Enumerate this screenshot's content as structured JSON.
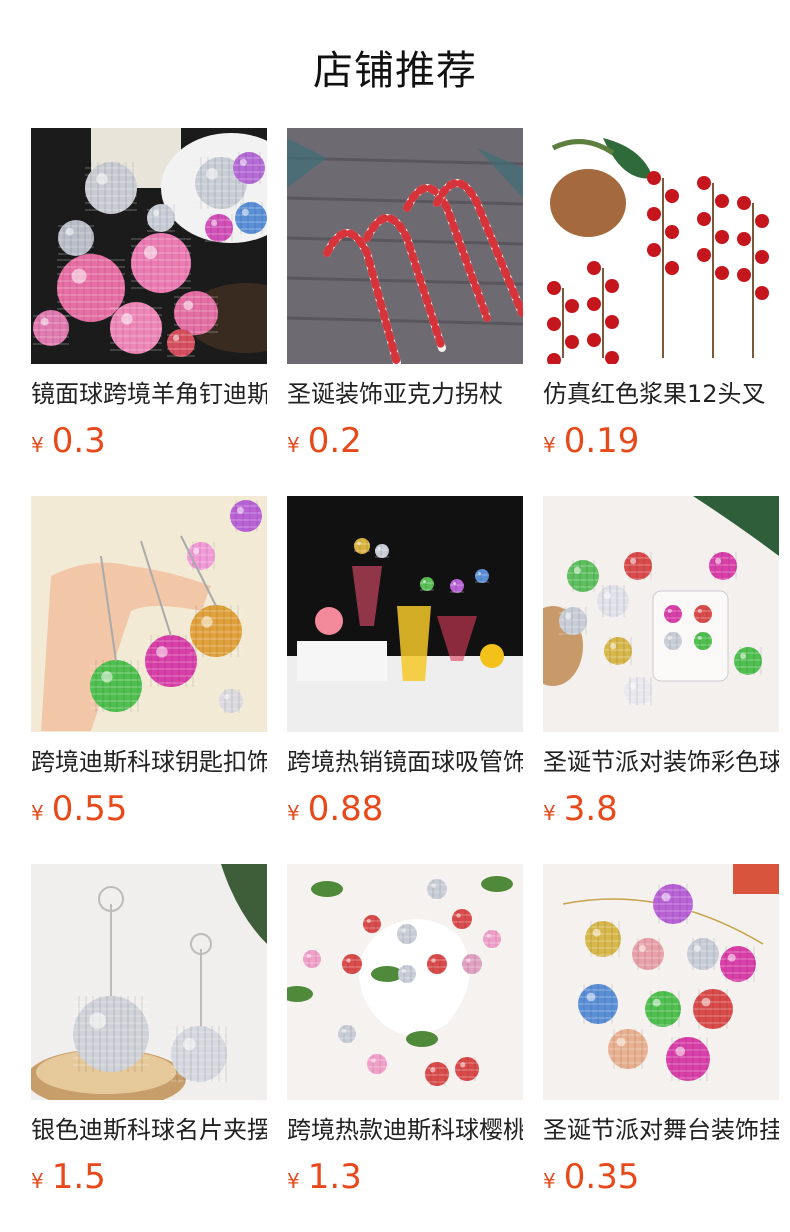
{
  "page_title": "店铺推荐",
  "currency_symbol": "¥",
  "colors": {
    "price": "#e8491b"
  },
  "products": [
    {
      "name": "镜面球跨境羊角钉迪斯科球",
      "price": "0.3",
      "image": "disco-balls-with-wine-bottle"
    },
    {
      "name": "圣诞装饰亚克力拐杖",
      "price": "0.2",
      "image": "candy-canes-on-wood"
    },
    {
      "name": "仿真红色浆果12头叉",
      "price": "0.19",
      "image": "red-berries-pinecone"
    },
    {
      "name": "跨境迪斯科球钥匙扣饰品",
      "price": "0.55",
      "image": "disco-ball-keychains-in-hand"
    },
    {
      "name": "跨境热销镜面球吸管饰品",
      "price": "0.88",
      "image": "disco-ball-straws-drinks"
    },
    {
      "name": "圣诞节派对装饰彩色球",
      "price": "3.8",
      "image": "colored-ornament-balls-box"
    },
    {
      "name": "银色迪斯科球名片夹摆件",
      "price": "1.5",
      "image": "silver-disco-ball-card-holders"
    },
    {
      "name": "跨境热款迪斯科球樱桃挂件",
      "price": "1.3",
      "image": "disco-ball-cherries"
    },
    {
      "name": "圣诞节派对舞台装饰挂球",
      "price": "0.35",
      "image": "hanging-disco-ornaments"
    }
  ]
}
